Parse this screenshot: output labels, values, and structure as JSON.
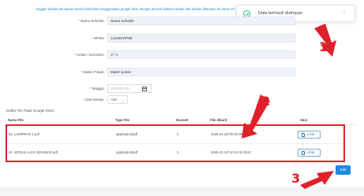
{
  "notice": "Unggah berkas berukuran besar lebih baik menggunakan google drive dengan permisi diakses bebas dan berkan ditampan ke lamar ini!",
  "toast": {
    "message": "Data berhasil disimpan",
    "close": "×",
    "icon": "check-circle-icon",
    "accent": "#34b77e"
  },
  "form": {
    "nama_sekolah": {
      "label": "Nama Sekolah :",
      "value": "Nama Sekolah"
    },
    "npsn": {
      "label": "NPSN :",
      "value": "12345678789"
    },
    "kelas": {
      "label": "Kelas / Semester :",
      "value": "V / 1"
    },
    "materi": {
      "label": "Materi Pokok :",
      "value": "Materi pokok"
    },
    "tanggal": {
      "label": "Tanggal :",
      "placeholder": "2026-01-15"
    },
    "lihat_berkas": {
      "label": "Lihat berkas :",
      "value": "KM"
    }
  },
  "section_title": "Daftar File Pada Google Drive",
  "table": {
    "headers": [
      "Nama File",
      "Type File",
      "Diunset",
      "File diburit",
      "Aksi"
    ],
    "rows": [
      {
        "name": "02. LAMPIRAN 1.pdf",
        "type": "application/pdf",
        "size": "0",
        "date": "2026-01-15T05:39:06.218Z",
        "action": "Lihat"
      },
      {
        "name": "01. MODUL AJAR SENSBAR.pdf",
        "type": "application/pdf",
        "size": "0",
        "date": "2026-01-14T10:41:40.812Z",
        "action": "Lihat"
      }
    ]
  },
  "edit_button": "Edit",
  "markers": [
    "1",
    "2",
    "3"
  ],
  "colors": {
    "primary": "#1e88e5",
    "highlight": "#e0202a",
    "input_bg": "#eef2f8"
  }
}
